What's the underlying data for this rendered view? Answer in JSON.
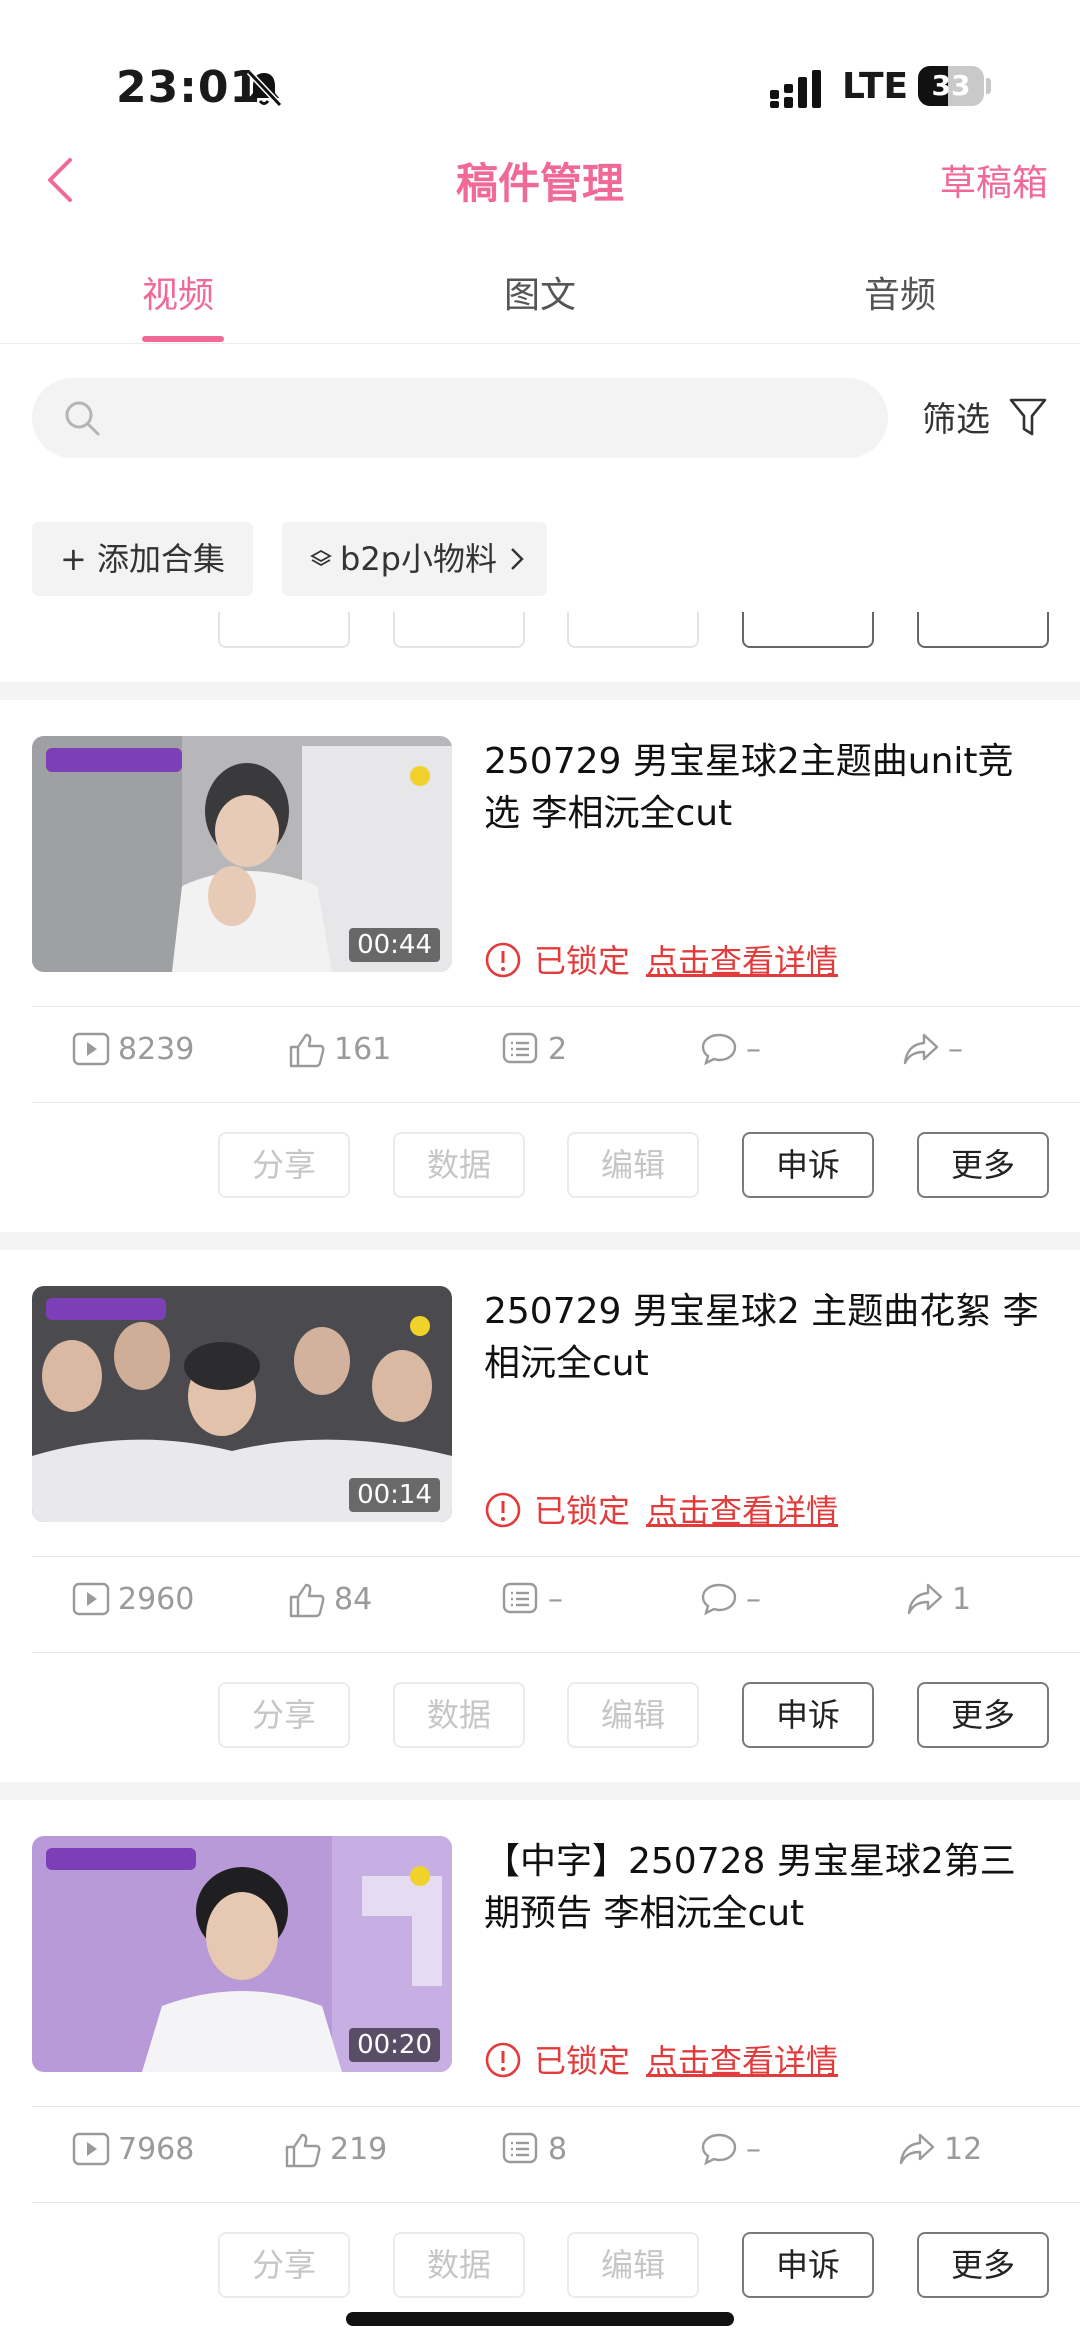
{
  "status_bar": {
    "time": "23:01",
    "network": "LTE",
    "battery": "33"
  },
  "nav": {
    "title": "稿件管理",
    "right_action": "草稿箱"
  },
  "tabs": [
    {
      "label": "视频",
      "active": true
    },
    {
      "label": "图文",
      "active": false
    },
    {
      "label": "音频",
      "active": false
    }
  ],
  "search": {
    "placeholder": "",
    "value": ""
  },
  "filter_label": "筛选",
  "chips": [
    {
      "label": "+ 添加合集"
    },
    {
      "label": "b2p小物料",
      "icon": "layers-icon"
    }
  ],
  "colors": {
    "accent": "#f06a95",
    "locked": "#e33b3b",
    "muted": "#9a9a9a"
  },
  "videos": [
    {
      "title": "250729 男宝星球2主题曲unit竞选 李相沅全cut",
      "duration": "00:44",
      "status": "已锁定",
      "detail_link": "点击查看详情",
      "views": "8239",
      "likes": "161",
      "danmaku": "2",
      "comments": "–",
      "shares": "–",
      "buttons": [
        "分享",
        "数据",
        "编辑",
        "申诉",
        "更多"
      ]
    },
    {
      "title": "250729 男宝星球2 主题曲花絮 李相沅全cut",
      "duration": "00:14",
      "status": "已锁定",
      "detail_link": "点击查看详情",
      "views": "2960",
      "likes": "84",
      "danmaku": "–",
      "comments": "–",
      "shares": "1",
      "buttons": [
        "分享",
        "数据",
        "编辑",
        "申诉",
        "更多"
      ]
    },
    {
      "title": "【中字】250728 男宝星球2第三期预告 李相沅全cut",
      "duration": "00:20",
      "status": "已锁定",
      "detail_link": "点击查看详情",
      "views": "7968",
      "likes": "219",
      "danmaku": "8",
      "comments": "–",
      "shares": "12",
      "buttons": [
        "分享",
        "数据",
        "编辑",
        "申诉",
        "更多"
      ]
    }
  ]
}
